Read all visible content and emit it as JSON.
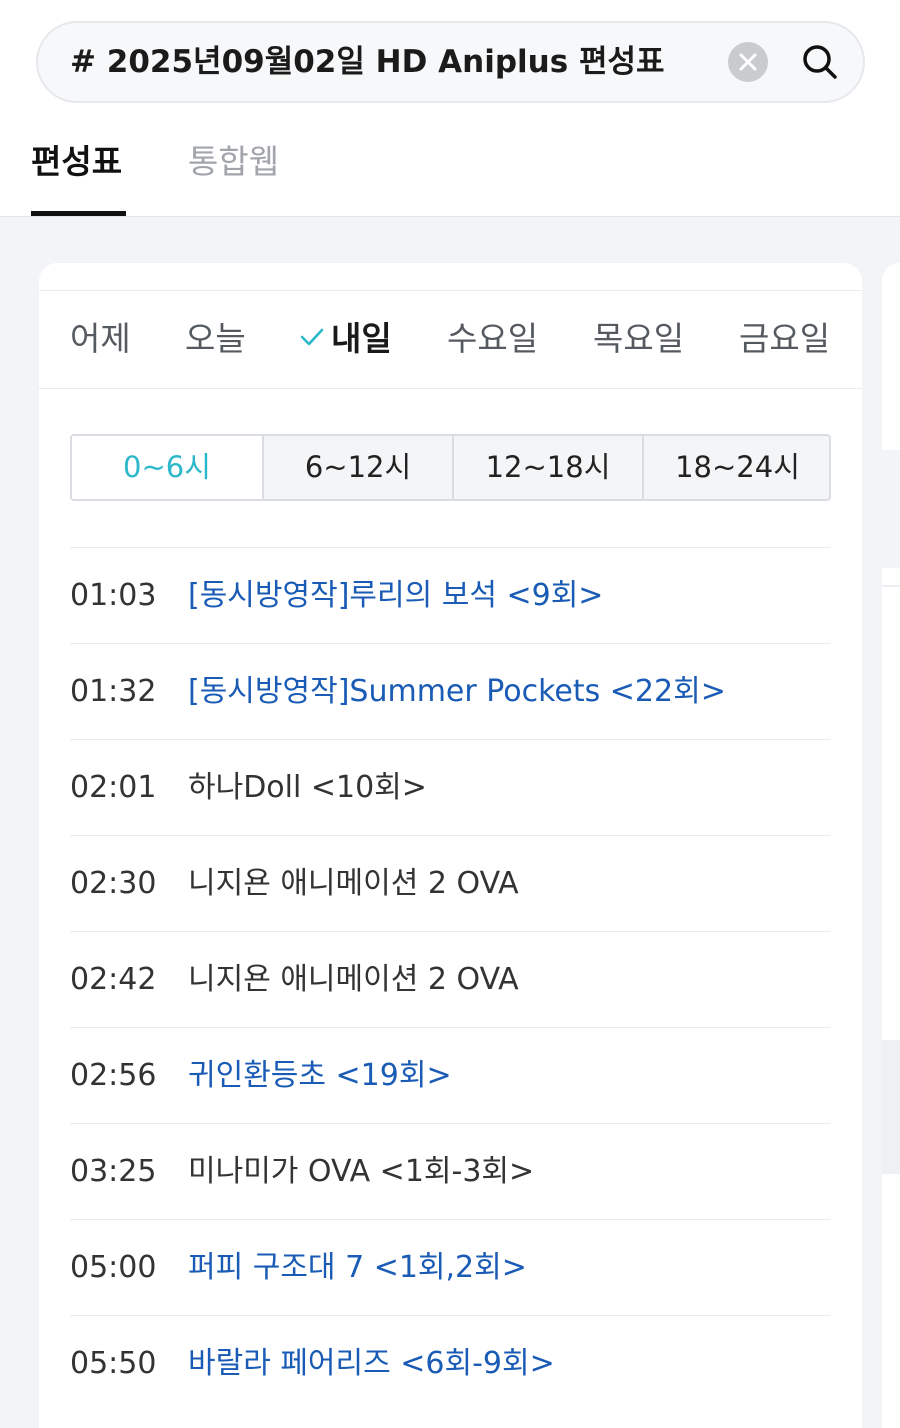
{
  "search": {
    "query": "# 2025년09월02일 HD Aniplus 편성표",
    "clear_icon": "close-circle-icon",
    "search_icon": "magnifier-icon"
  },
  "tabs": [
    {
      "label": "편성표",
      "active": true
    },
    {
      "label": "통합웹",
      "active": false
    }
  ],
  "days": [
    {
      "label": "어제",
      "active": false
    },
    {
      "label": "오늘",
      "active": false
    },
    {
      "label": "내일",
      "active": true
    },
    {
      "label": "수요일",
      "active": false
    },
    {
      "label": "목요일",
      "active": false
    },
    {
      "label": "금요일",
      "active": false
    }
  ],
  "time_ranges": [
    {
      "label": "0~6시",
      "active": true
    },
    {
      "label": "6~12시",
      "active": false
    },
    {
      "label": "12~18시",
      "active": false
    },
    {
      "label": "18~24시",
      "active": false
    }
  ],
  "schedule": [
    {
      "time": "01:03",
      "title": "[동시방영작]루리의 보석 <9회>",
      "link": true
    },
    {
      "time": "01:32",
      "title": "[동시방영작]Summer Pockets <22회>",
      "link": true
    },
    {
      "time": "02:01",
      "title": "하나Doll <10회>",
      "link": false
    },
    {
      "time": "02:30",
      "title": "니지욘 애니메이션 2 OVA",
      "link": false
    },
    {
      "time": "02:42",
      "title": "니지욘 애니메이션 2 OVA",
      "link": false
    },
    {
      "time": "02:56",
      "title": "귀인환등초 <19회>",
      "link": true
    },
    {
      "time": "03:25",
      "title": "미나미가 OVA <1회-3회>",
      "link": false
    },
    {
      "time": "05:00",
      "title": "퍼피 구조대 7 <1회,2회>",
      "link": true
    },
    {
      "time": "05:50",
      "title": "바랄라 페어리즈 <6회-9회>",
      "link": true
    }
  ],
  "colors": {
    "link": "#1a5bb5",
    "accent": "#2bb8c9",
    "background": "#f3f4f7"
  }
}
